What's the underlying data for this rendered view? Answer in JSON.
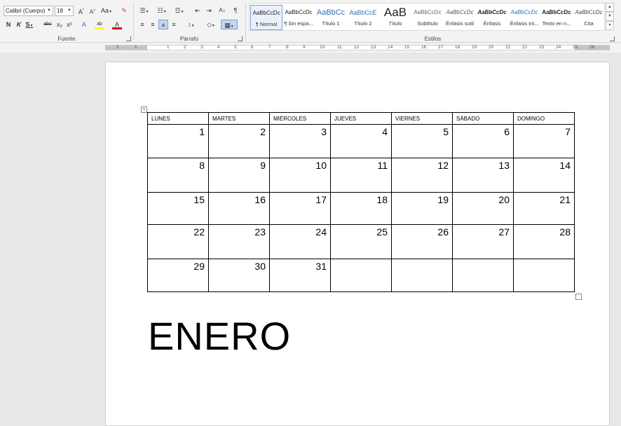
{
  "ribbon": {
    "font": {
      "label": "Fuente",
      "font_name": "Calibri (Cuerpo)",
      "font_size": "18",
      "grow_icon": "A^",
      "shrink_icon": "A˅",
      "case_label": "Aa",
      "bold": "N",
      "italic": "K",
      "underline": "S",
      "strike": "abc",
      "subscript": "x₂",
      "superscript": "x²",
      "effects": "A",
      "highlight": "ab",
      "fontcolor": "A"
    },
    "paragraph": {
      "label": "Párrafo",
      "sort": "A↓",
      "marks": "¶"
    },
    "styles": {
      "label": "Estilos",
      "items": [
        {
          "preview": "AaBbCcDc",
          "name": "¶ Normal"
        },
        {
          "preview": "AaBbCcDc",
          "name": "¶ Sin espa..."
        },
        {
          "preview": "AaBbCc",
          "name": "Título 1"
        },
        {
          "preview": "AaBbCcE",
          "name": "Título 2"
        },
        {
          "preview": "AaB",
          "name": "Título"
        },
        {
          "preview": "AaBbCcDc",
          "name": "Subtítulo"
        },
        {
          "preview": "AaBbCcDc",
          "name": "Énfasis sutil"
        },
        {
          "preview": "AaBbCcDc",
          "name": "Énfasis"
        },
        {
          "preview": "AaBbCcDc",
          "name": "Énfasis int..."
        },
        {
          "preview": "AaBbCcDc",
          "name": "Texto en n..."
        },
        {
          "preview": "AaBbCcDc",
          "name": "Cita"
        }
      ]
    }
  },
  "ruler": {
    "ticks": [
      "2",
      "1",
      "1",
      "2",
      "3",
      "4",
      "5",
      "6",
      "7",
      "8",
      "9",
      "10",
      "11",
      "12",
      "13",
      "14",
      "15",
      "16",
      "17",
      "18",
      "19",
      "20",
      "21",
      "22",
      "23",
      "24",
      "25",
      "26"
    ]
  },
  "calendar": {
    "days": [
      "LUNES",
      "MARTES",
      "MIÉRCOLES",
      "JUEVES",
      "VIERNES",
      "SÁBADO",
      "DOMINGO"
    ],
    "weeks": [
      [
        "1",
        "2",
        "3",
        "4",
        "5",
        "6",
        "7"
      ],
      [
        "8",
        "9",
        "10",
        "11",
        "12",
        "13",
        "14"
      ],
      [
        "15",
        "16",
        "17",
        "18",
        "19",
        "20",
        "21"
      ],
      [
        "22",
        "23",
        "24",
        "25",
        "26",
        "27",
        "28"
      ],
      [
        "29",
        "30",
        "31",
        "",
        "",
        "",
        ""
      ]
    ],
    "month": "ENERO"
  },
  "colors": {
    "highlight_yellow": "#ffff00",
    "font_red": "#e00000",
    "selection_blue": "#7a9cd3"
  }
}
